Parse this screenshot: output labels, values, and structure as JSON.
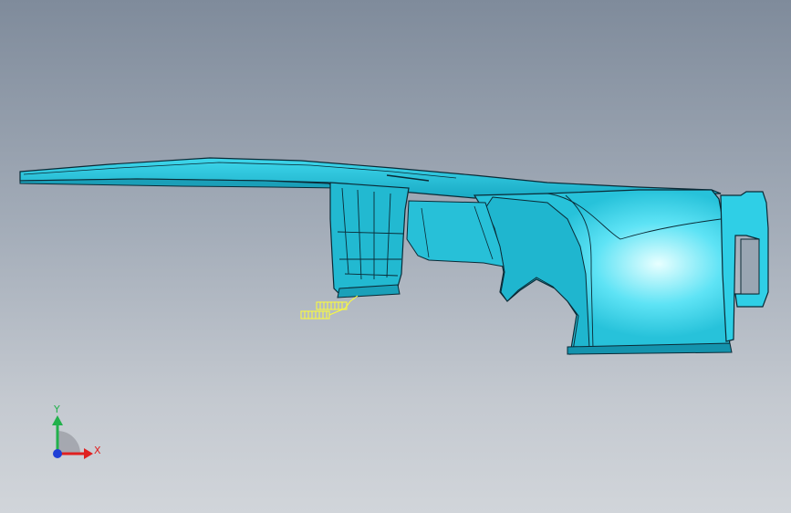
{
  "viewport": {
    "background_top": "#7f8b9b",
    "background_bottom": "#d1d5da"
  },
  "model": {
    "type": "3d-part",
    "shading": "shaded-with-edges",
    "surface_color": "#29c9e0",
    "edge_color": "#0a2a36",
    "selected_feature_color": "#ffff33",
    "selected_feature": "annotation-leader"
  },
  "triad": {
    "x_label": "X",
    "y_label": "Y",
    "x_color": "#e02020",
    "y_color": "#22b14c",
    "z_color": "#1f3fd6"
  }
}
